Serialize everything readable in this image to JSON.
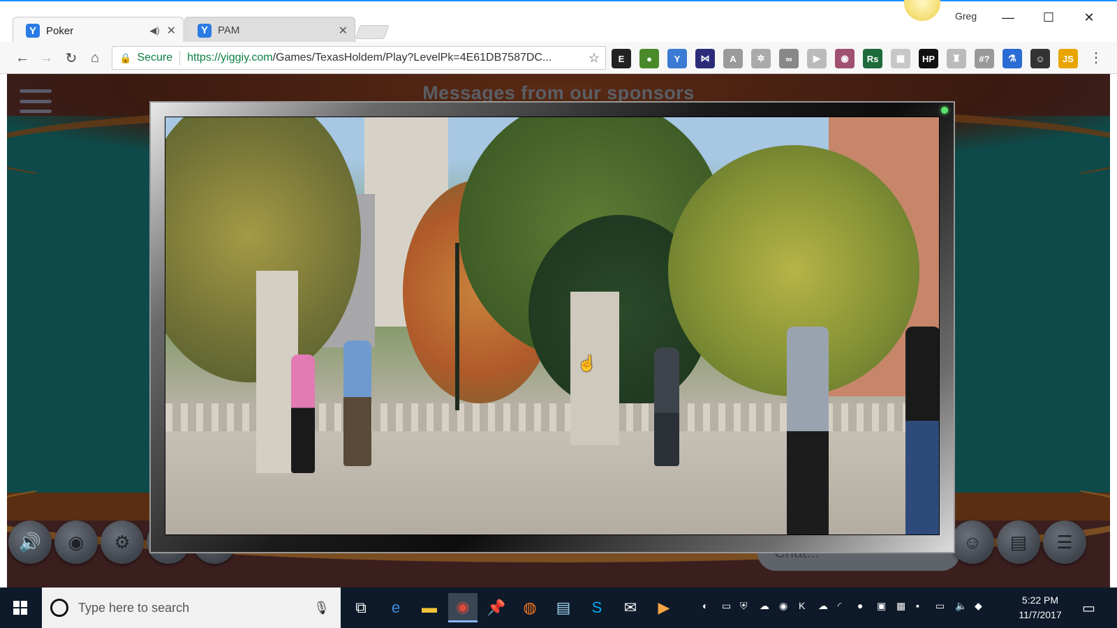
{
  "browser": {
    "tabs": [
      {
        "label": "Poker",
        "favicon": "Y",
        "audio": true
      },
      {
        "label": "PAM",
        "favicon": "Y",
        "audio": false
      }
    ],
    "profile_name": "Greg",
    "omnibox": {
      "secure_label": "Secure",
      "url_scheme_host": "https://yiggiy.com",
      "url_path": "/Games/TexasHoldem/Play?LevelPk=4E61DB7587DC..."
    },
    "extensions": [
      {
        "name": "evernote-icon",
        "glyph": "E",
        "color": "#222222"
      },
      {
        "name": "leaf-icon",
        "glyph": "●",
        "color": "#4a8a2a"
      },
      {
        "name": "yiggiy-icon",
        "glyph": "Y",
        "color": "#3b7bd4"
      },
      {
        "name": "visual-studio-icon",
        "glyph": "⋈",
        "color": "#2b2b7a"
      },
      {
        "name": "translate-icon",
        "glyph": "A",
        "color": "#9a9a9a"
      },
      {
        "name": "gear-ext-icon",
        "glyph": "✲",
        "color": "#aaaaaa"
      },
      {
        "name": "glasses-icon",
        "glyph": "∞",
        "color": "#888888"
      },
      {
        "name": "play-ext-icon",
        "glyph": "▶",
        "color": "#bbbbbb"
      },
      {
        "name": "owl-icon",
        "glyph": "◉",
        "color": "#a05070"
      },
      {
        "name": "rs-icon",
        "glyph": "Rs",
        "color": "#1d6b3a"
      },
      {
        "name": "grid-icon",
        "glyph": "▦",
        "color": "#c7c7c7"
      },
      {
        "name": "hp-icon",
        "glyph": "HP",
        "color": "#111111"
      },
      {
        "name": "shirt-icon",
        "glyph": "♜",
        "color": "#bbbbbb"
      },
      {
        "name": "hash-icon",
        "glyph": "#?",
        "color": "#999999"
      },
      {
        "name": "flask-icon",
        "glyph": "⚗",
        "color": "#2b6bd4"
      },
      {
        "name": "smiley-icon",
        "glyph": "☺",
        "color": "#333333"
      },
      {
        "name": "js-icon",
        "glyph": "JS",
        "color": "#e8a500"
      }
    ]
  },
  "game": {
    "sponsors_title": "Messages from our sponsors",
    "chat_placeholder": "Chat...",
    "bottom_buttons_left": [
      "speaker-icon",
      "eye-icon",
      "settings-icon",
      "help-icon",
      "search-icon"
    ],
    "bottom_buttons_right": [
      "emoji-icon",
      "chat-icon",
      "list-icon"
    ]
  },
  "taskbar": {
    "search_placeholder": "Type here to search",
    "pinned_apps": [
      {
        "name": "task-view-icon",
        "glyph": "⧉",
        "color": "#ffffff"
      },
      {
        "name": "edge-icon",
        "glyph": "e",
        "color": "#3b8de0"
      },
      {
        "name": "file-explorer-icon",
        "glyph": "▬",
        "color": "#f3c33b"
      },
      {
        "name": "chrome-icon",
        "glyph": "◉",
        "color": "#dd4b39"
      },
      {
        "name": "pin-icon",
        "glyph": "📌",
        "color": "#e74c3c"
      },
      {
        "name": "firefox-icon",
        "glyph": "◍",
        "color": "#ff7b19"
      },
      {
        "name": "notepad-icon",
        "glyph": "▤",
        "color": "#9fd3f0"
      },
      {
        "name": "skype-icon",
        "glyph": "S",
        "color": "#00a9f0"
      },
      {
        "name": "mail-icon",
        "glyph": "✉",
        "color": "#ffffff"
      },
      {
        "name": "media-icon",
        "glyph": "▶",
        "color": "#f7a541"
      }
    ],
    "clock_time": "5:22 PM",
    "clock_date": "11/7/2017"
  }
}
